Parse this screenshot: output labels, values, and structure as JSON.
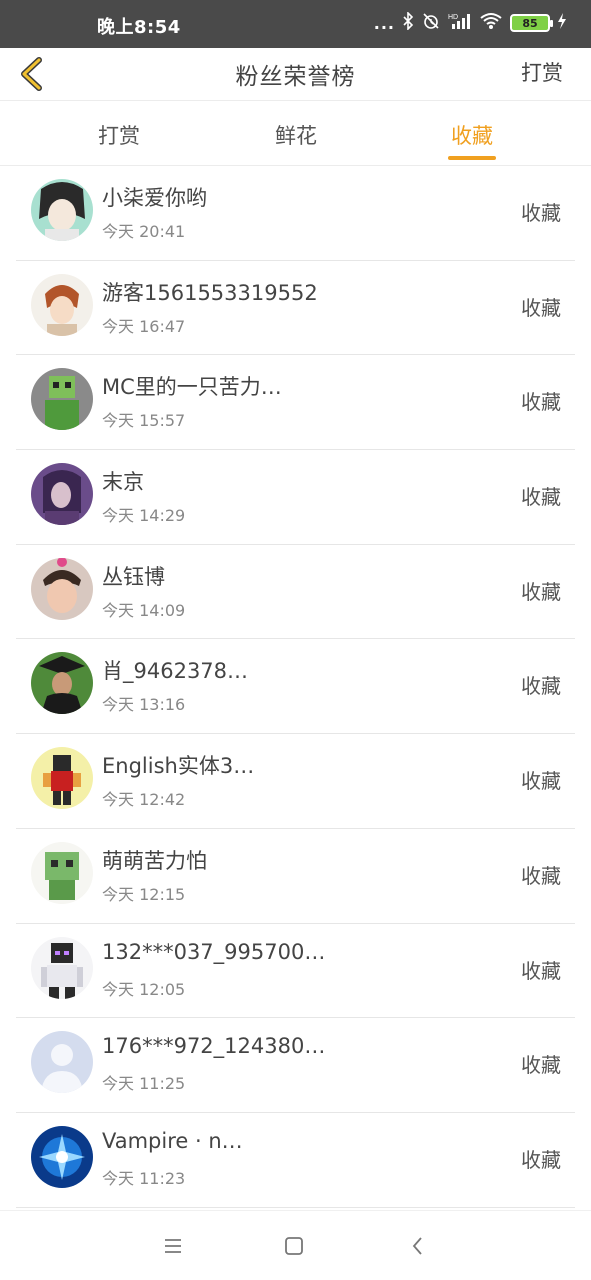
{
  "status_bar": {
    "time": "晚上8:54",
    "dots": "...",
    "icons": [
      "bluetooth-icon",
      "alarm-off-icon",
      "hd-signal-icon",
      "wifi-icon",
      "charging-icon"
    ],
    "battery": "85"
  },
  "header": {
    "title": "粉丝荣誉榜",
    "right_action": "打赏"
  },
  "tabs": [
    {
      "label": "打赏",
      "active": false
    },
    {
      "label": "鲜花",
      "active": false
    },
    {
      "label": "收藏",
      "active": true
    }
  ],
  "accent_color": "#f0a020",
  "fans": [
    {
      "name": "小柒爱你哟",
      "time": "今天 20:41",
      "action": "收藏"
    },
    {
      "name": "游客1561553319552",
      "time": "今天 16:47",
      "action": "收藏"
    },
    {
      "name": "MC里的一只苦力…",
      "time": "今天 15:57",
      "action": "收藏"
    },
    {
      "name": "末京",
      "time": "今天 14:29",
      "action": "收藏"
    },
    {
      "name": "丛钰博",
      "time": "今天 14:09",
      "action": "收藏"
    },
    {
      "name": "肖_9462378…",
      "time": "今天 13:16",
      "action": "收藏"
    },
    {
      "name": "English实体3…",
      "time": "今天 12:42",
      "action": "收藏"
    },
    {
      "name": "萌萌苦力怕",
      "time": "今天 12:15",
      "action": "收藏"
    },
    {
      "name": "132***037_995700…",
      "time": "今天 12:05",
      "action": "收藏"
    },
    {
      "name": "176***972_124380…",
      "time": "今天 11:25",
      "action": "收藏"
    },
    {
      "name": "Vampire · n…",
      "time": "今天 11:23",
      "action": "收藏"
    }
  ]
}
